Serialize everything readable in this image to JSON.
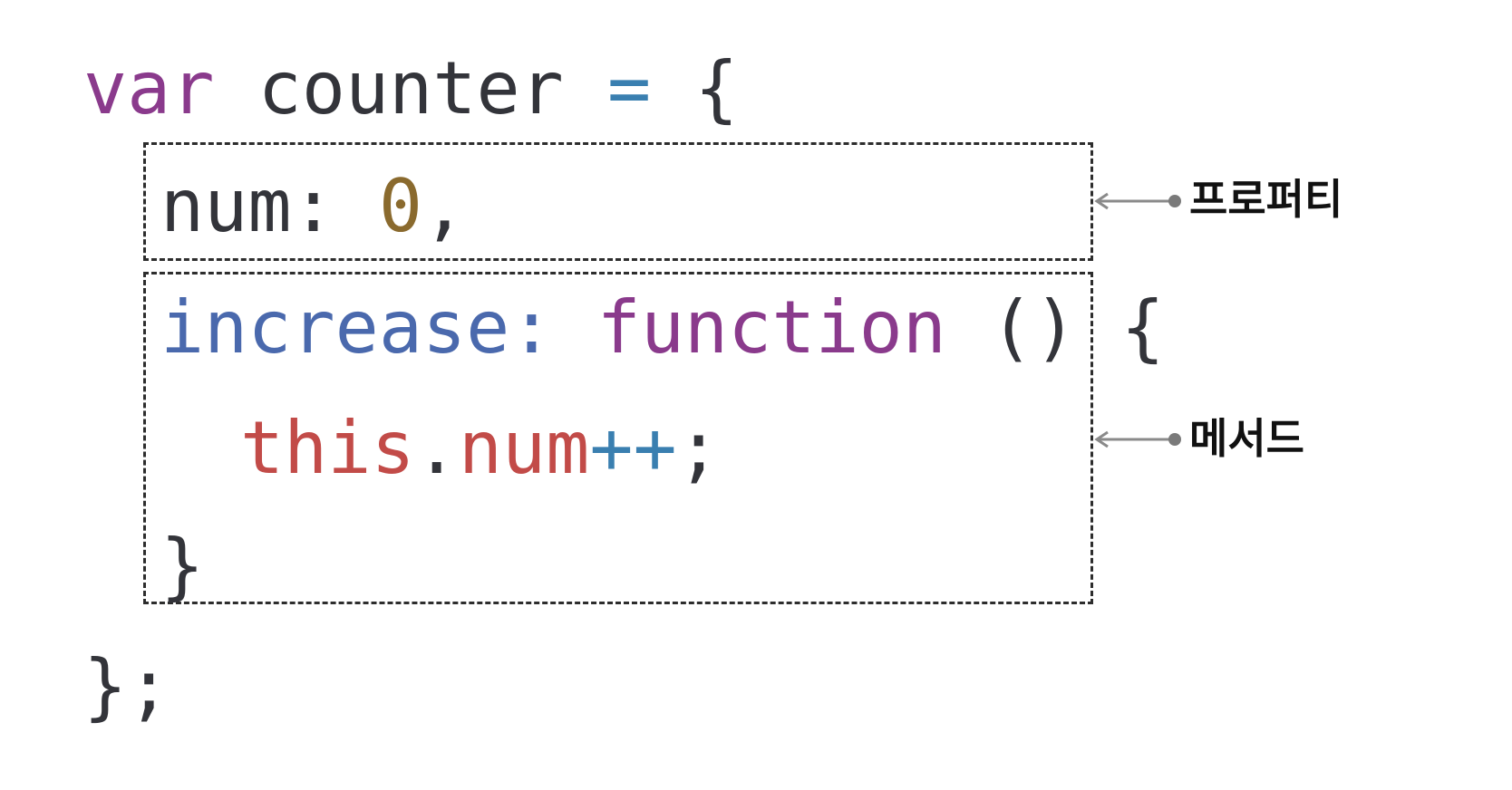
{
  "code": {
    "line1": {
      "keyword": "var",
      "name": "counter",
      "equals": "=",
      "brace": "{"
    },
    "line2": {
      "key": "num:",
      "value": "0",
      "comma": ","
    },
    "line3": {
      "key": "increase:",
      "keyword": "function",
      "parens": "()",
      "brace": "{"
    },
    "line4": {
      "this_kw": "this",
      "dot": ".",
      "member": "num",
      "incr": "++",
      "semi": ";"
    },
    "line5": {
      "brace": "}"
    },
    "line6": {
      "closing": "};"
    }
  },
  "annotations": {
    "property_label": "프로퍼티",
    "method_label": "메서드"
  },
  "colors": {
    "keyword": "#8a3a8c",
    "identifier": "#33343a",
    "operator": "#3a7fb0",
    "number": "#8a6a2e",
    "property": "#4a69ad",
    "this": "#c24b48",
    "arrow": "#8a8a8a"
  }
}
